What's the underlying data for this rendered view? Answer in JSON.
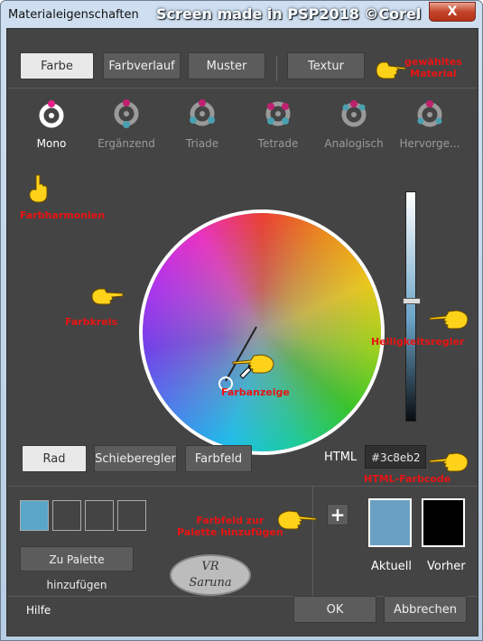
{
  "window": {
    "title": "Materialeigenschaften",
    "overlay_caption": "Screen made in PSP2018 ©Corel",
    "close_label": "X"
  },
  "top_tabs": [
    {
      "label": "Farbe",
      "selected": true
    },
    {
      "label": "Farbverlauf",
      "selected": false
    },
    {
      "label": "Muster",
      "selected": false
    },
    {
      "label": "Textur",
      "selected": false
    }
  ],
  "harmonies": [
    {
      "label": "Mono",
      "selected": true,
      "icon": "mono-icon"
    },
    {
      "label": "Ergänzend",
      "selected": false,
      "icon": "complementary-icon"
    },
    {
      "label": "Triade",
      "selected": false,
      "icon": "triad-icon"
    },
    {
      "label": "Tetrade",
      "selected": false,
      "icon": "tetrad-icon"
    },
    {
      "label": "Analogisch",
      "selected": false,
      "icon": "analogous-icon"
    },
    {
      "label": "Hervorge...",
      "selected": false,
      "icon": "highlight-icon"
    }
  ],
  "mode_tabs": [
    {
      "label": "Rad",
      "selected": true
    },
    {
      "label": "Schieberegler",
      "selected": false
    },
    {
      "label": "Farbfeld",
      "selected": false
    }
  ],
  "html": {
    "label": "HTML",
    "value": "#3c8eb2"
  },
  "palette": {
    "swatch_colors": [
      "#5aa6c8",
      "#444444",
      "#444444",
      "#444444"
    ],
    "add_button_label": "Zu Palette hinzufügen",
    "plus_label": "+"
  },
  "current": {
    "label": "Aktuell",
    "color": "#6aa0c4"
  },
  "previous": {
    "label": "Vorher",
    "color": "#000000"
  },
  "footer": {
    "help": "Hilfe",
    "ok": "OK",
    "cancel": "Abbrechen"
  },
  "annotations": {
    "material_line1": "gewähltes",
    "material_line2": "Material",
    "harmonies": "Farbharmonien",
    "wheel": "Farbkreis",
    "color_display": "Farbanzeige",
    "brightness": "Helligkeitsregler",
    "html_code": "HTML-Farbcode",
    "add_line1": "Farbfeld zur",
    "add_line2": "Palette hinzufügen"
  },
  "watermark": {
    "line1": "VR",
    "line2": "Saruna"
  },
  "accent_red": "#e81414",
  "slider_level": 0.47
}
